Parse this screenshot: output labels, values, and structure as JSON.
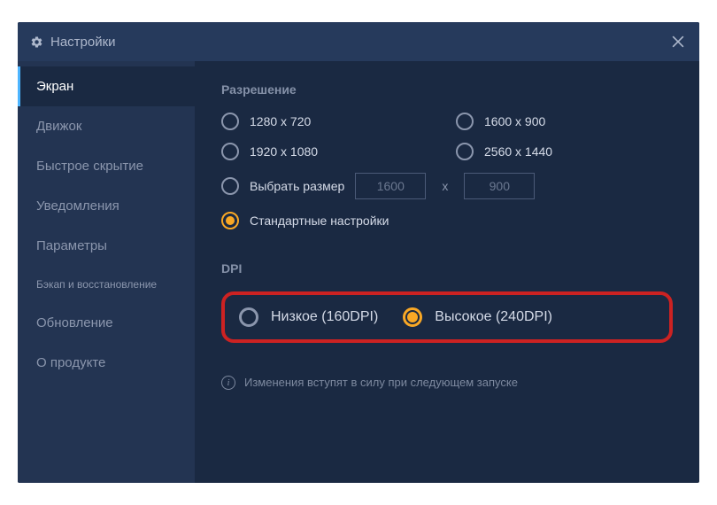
{
  "titlebar": {
    "title": "Настройки"
  },
  "sidebar": {
    "items": [
      {
        "label": "Экран",
        "active": true
      },
      {
        "label": "Движок"
      },
      {
        "label": "Быстрое скрытие"
      },
      {
        "label": "Уведомления"
      },
      {
        "label": "Параметры"
      },
      {
        "label": "Бэкап и восстановление",
        "small": true
      },
      {
        "label": "Обновление"
      },
      {
        "label": "О продукте"
      }
    ]
  },
  "resolution": {
    "title": "Разрешение",
    "options": [
      "1280 x 720",
      "1600 x 900",
      "1920 x 1080",
      "2560 x 1440"
    ],
    "customLabel": "Выбрать размер",
    "customWidth": "1600",
    "customHeight": "900",
    "xSep": "x",
    "defaultLabel": "Стандартные настройки"
  },
  "dpi": {
    "title": "DPI",
    "lowLabel": "Низкое (160DPI)",
    "highLabel": "Высокое (240DPI)"
  },
  "info": {
    "text": "Изменения вступят в силу при следующем запуске"
  }
}
